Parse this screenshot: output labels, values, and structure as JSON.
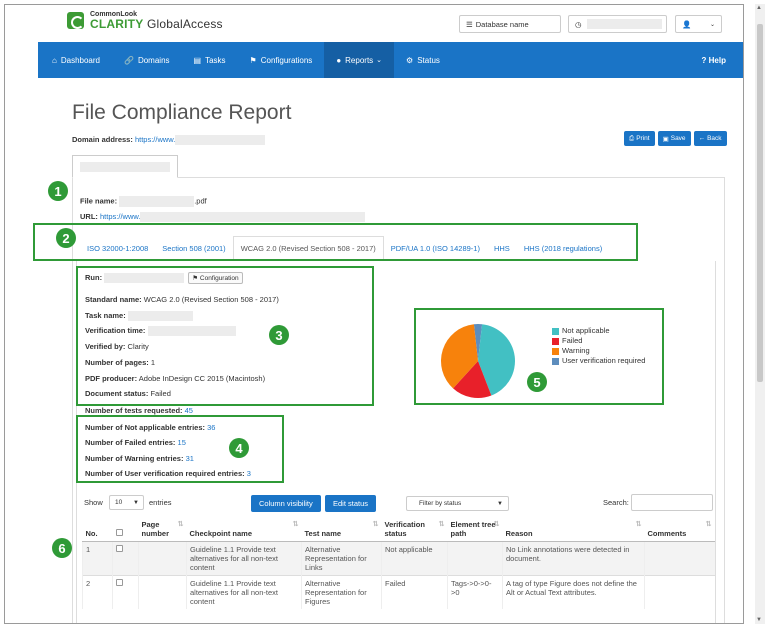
{
  "app": {
    "logo_small": "CommonLook",
    "logo_brand": "CLARITY",
    "logo_product": "GlobalAccess",
    "database_placeholder": "Database name"
  },
  "nav": {
    "items": [
      {
        "icon": "⌂",
        "label": "Dashboard"
      },
      {
        "icon": "🔗",
        "label": "Domains"
      },
      {
        "icon": "▤",
        "label": "Tasks"
      },
      {
        "icon": "⚑",
        "label": "Configurations"
      },
      {
        "icon": "●",
        "label": "Reports"
      },
      {
        "icon": "⚙",
        "label": "Status"
      }
    ],
    "help": "? Help"
  },
  "page": {
    "title": "File Compliance Report",
    "domain_label": "Domain address:",
    "domain_value": "https://www.",
    "buttons": {
      "print": "Print",
      "save": "Save",
      "back": "Back"
    }
  },
  "file": {
    "name_label": "File name:",
    "name_suffix": ".pdf",
    "url_label": "URL:",
    "url_value": "https://www."
  },
  "standard_tabs": [
    "ISO 32000-1:2008",
    "Section 508 (2001)",
    "WCAG 2.0 (Revised Section 508 - 2017)",
    "PDF/UA 1.0 (ISO 14289-1)",
    "HHS",
    "HHS (2018 regulations)"
  ],
  "run": {
    "run_label": "Run:",
    "config_button": "Configuration",
    "standard_label": "Standard name:",
    "standard_value": "WCAG 2.0 (Revised Section 508 - 2017)",
    "task_label": "Task name:",
    "verification_time_label": "Verification time:",
    "verified_by_label": "Verified by:",
    "verified_by_value": "Clarity",
    "pages_label": "Number of pages:",
    "pages_value": "1",
    "producer_label": "PDF producer:",
    "producer_value": "Adobe InDesign CC 2015 (Macintosh)",
    "status_label": "Document status:",
    "status_value": "Failed",
    "tests_label": "Number of tests requested:",
    "tests_value": "45"
  },
  "counts": {
    "na_label": "Number of Not applicable entries:",
    "na_value": "36",
    "failed_label": "Number of Failed entries:",
    "failed_value": "15",
    "warning_label": "Number of Warning entries:",
    "warning_value": "31",
    "user_label": "Number of User verification required entries:",
    "user_value": "3"
  },
  "chart_data": {
    "type": "pie",
    "categories": [
      "Not applicable",
      "Failed",
      "Warning",
      "User verification required"
    ],
    "values": [
      36,
      15,
      31,
      3
    ],
    "colors": [
      "#42c0c3",
      "#e8202a",
      "#f7820c",
      "#5d8dbd"
    ],
    "legend": "right"
  },
  "table_controls": {
    "show_label": "Show",
    "show_value": "10",
    "entries_label": "entries",
    "column_visibility": "Column visibility",
    "edit_status": "Edit status",
    "filter_placeholder": "Filter by status",
    "search_label": "Search:"
  },
  "table": {
    "headers": [
      "No.",
      "",
      "Page number",
      "Checkpoint name",
      "Test name",
      "Verification status",
      "Element tree path",
      "Reason",
      "Comments"
    ],
    "rows": [
      {
        "no": "1",
        "page": "",
        "checkpoint": "Guideline 1.1 Provide text alternatives for all non-text content",
        "test": "Alternative Representation for Links",
        "status": "Not applicable",
        "path": "",
        "reason": "No Link annotations were detected in document.",
        "comments": ""
      },
      {
        "no": "2",
        "page": "",
        "checkpoint": "Guideline 1.1 Provide text alternatives for all non-text content",
        "test": "Alternative Representation for Figures",
        "status": "Failed",
        "path": "Tags->0->0->0",
        "reason": "A tag of type Figure does not define the Alt or Actual Text attributes.",
        "comments": ""
      }
    ]
  },
  "annotations": [
    "1",
    "2",
    "3",
    "4",
    "5",
    "6"
  ]
}
